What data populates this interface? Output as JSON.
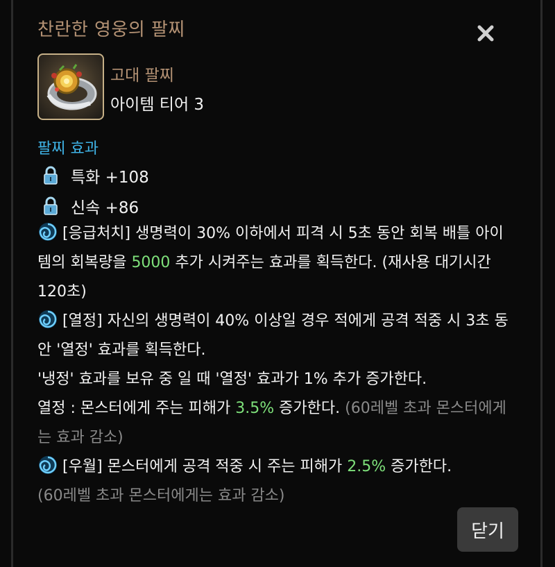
{
  "dialog": {
    "title": "찬란한 영웅의 팔찌",
    "close_icon": "close-x-icon",
    "item": {
      "icon": "bracelet-item-icon",
      "type": "고대 팔찌",
      "tier": "아이템 티어 3"
    },
    "effects_title": "팔찌 효과",
    "stats": [
      {
        "icon": "lock-icon",
        "label": "특화 +108"
      },
      {
        "icon": "lock-icon",
        "label": "신속 +86"
      }
    ],
    "effect1": {
      "icon": "swirl-icon",
      "before": "[응급처치] 생명력이 30% 이하에서 피격 시 5초 동안 회복 배틀 아이템의 회복량을 ",
      "highlight": "5000",
      "after": " 추가 시켜주는 효과를 획득한다. (재사용 대기시간 120초)"
    },
    "effect2": {
      "icon": "swirl-icon",
      "line1": "[열정] 자신의 생명력이 40% 이상일 경우 적에게 공격 적중 시 3초 동안 '열정' 효과를 획득한다.",
      "line2": "'냉정' 효과를 보유 중 일 때 '열정' 효과가 1% 추가 증가한다.",
      "line3_before": "열정 : 몬스터에게 주는 피해가 ",
      "line3_highlight": "3.5%",
      "line3_after": " 증가한다. ",
      "line3_note": "(60레벨 초과 몬스터에게는 효과 감소)"
    },
    "effect3": {
      "icon": "swirl-icon",
      "before": "[우월] 몬스터에게 공격 적중 시 주는 피해가 ",
      "highlight": "2.5%",
      "after": " 증가한다.",
      "note": "(60레벨 초과 몬스터에게는 효과 감소)"
    },
    "close_button": "닫기",
    "colors": {
      "title": "#b49274",
      "section": "#3fb3e6",
      "highlight": "#7ee07a",
      "note": "#8a8a8a"
    }
  }
}
